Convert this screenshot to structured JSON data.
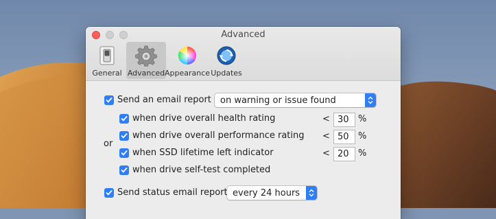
{
  "window": {
    "title": "Advanced"
  },
  "toolbar": {
    "items": [
      {
        "label": "General",
        "icon": "switch-icon",
        "selected": false
      },
      {
        "label": "Advanced",
        "icon": "gear-icon",
        "selected": true
      },
      {
        "label": "Appearance",
        "icon": "color-wheel-icon",
        "selected": false
      },
      {
        "label": "Updates",
        "icon": "updates-globe-icon",
        "selected": false
      }
    ]
  },
  "email": {
    "label": "Send an email report",
    "checked": true,
    "frequency": "on warning or issue found"
  },
  "conditions": {
    "or_label": "or",
    "items": [
      {
        "label": "when drive overall health rating",
        "checked": true,
        "comparator": "<",
        "threshold": "30",
        "unit": "%"
      },
      {
        "label": "when drive overall performance rating",
        "checked": true,
        "comparator": "<",
        "threshold": "50",
        "unit": "%"
      },
      {
        "label": "when SSD lifetime left indicator",
        "checked": true,
        "comparator": "<",
        "threshold": "20",
        "unit": "%"
      },
      {
        "label": "when drive self-test completed",
        "checked": true
      }
    ]
  },
  "status": {
    "label": "Send status email report",
    "checked": true,
    "frequency": "every 24 hours"
  },
  "colors": {
    "accent": "#2f7ef6",
    "close": "#fc605c"
  }
}
